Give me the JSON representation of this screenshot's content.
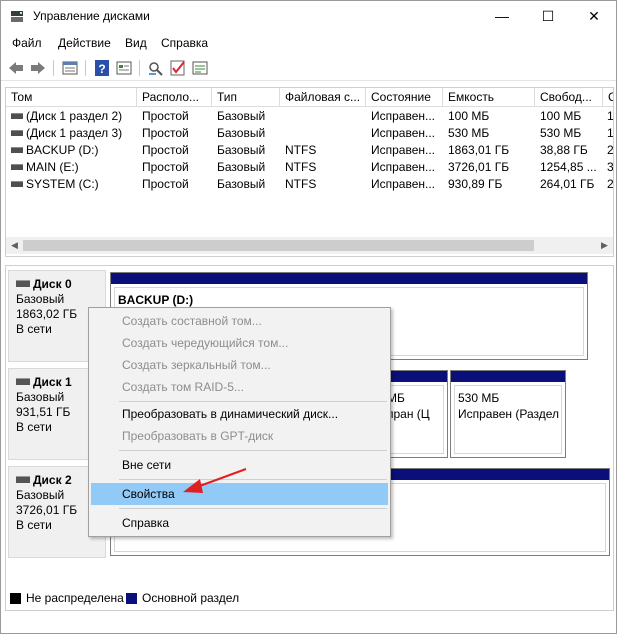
{
  "window": {
    "title": "Управление дисками",
    "controls": {
      "minimize": "—",
      "maximize": "☐",
      "close": "✕"
    }
  },
  "menu": [
    "Файл",
    "Действие",
    "Вид",
    "Справка"
  ],
  "toolbar_icons": [
    "back-arrow-icon",
    "forward-arrow-icon",
    "list-view-icon",
    "help-icon",
    "properties-icon",
    "connect-icon",
    "check-icon",
    "rescan-icon"
  ],
  "volumes": {
    "columns": [
      "Том",
      "Располо...",
      "Тип",
      "Файловая с...",
      "Состояние",
      "Емкость",
      "Свобод...",
      "С"
    ],
    "rows": [
      {
        "name": "(Диск 1 раздел 2)",
        "layout": "Простой",
        "type": "Базовый",
        "fs": "",
        "status": "Исправен...",
        "capacity": "100 МБ",
        "free": "100 МБ",
        "pct": "1"
      },
      {
        "name": "(Диск 1 раздел 3)",
        "layout": "Простой",
        "type": "Базовый",
        "fs": "",
        "status": "Исправен...",
        "capacity": "530 МБ",
        "free": "530 МБ",
        "pct": "1"
      },
      {
        "name": "BACKUP (D:)",
        "layout": "Простой",
        "type": "Базовый",
        "fs": "NTFS",
        "status": "Исправен...",
        "capacity": "1863,01 ГБ",
        "free": "38,88 ГБ",
        "pct": "2"
      },
      {
        "name": "MAIN (E:)",
        "layout": "Простой",
        "type": "Базовый",
        "fs": "NTFS",
        "status": "Исправен...",
        "capacity": "3726,01 ГБ",
        "free": "1254,85 ...",
        "pct": "3"
      },
      {
        "name": "SYSTEM (C:)",
        "layout": "Простой",
        "type": "Базовый",
        "fs": "NTFS",
        "status": "Исправен...",
        "capacity": "930,89 ГБ",
        "free": "264,01 ГБ",
        "pct": "2"
      }
    ]
  },
  "disks": [
    {
      "name": "Диск 0",
      "type": "Базовый",
      "size": "1863,02 ГБ",
      "state": "В сети"
    },
    {
      "name": "Диск 1",
      "type": "Базовый",
      "size": "931,51 ГБ",
      "state": "В сети"
    },
    {
      "name": "Диск 2",
      "type": "Базовый",
      "size": "3726,01 ГБ",
      "state": "В сети"
    }
  ],
  "partitions": {
    "backup_label": "BACKUP  (D:)",
    "disk1_p2_size": "МБ",
    "disk1_p2_status": "пран (Ц",
    "disk1_p3_size": "530 МБ",
    "disk1_p3_status": "Исправен (Раздел"
  },
  "context_menu": {
    "items": [
      {
        "label": "Создать составной том...",
        "enabled": false
      },
      {
        "label": "Создать чередующийся том...",
        "enabled": false
      },
      {
        "label": "Создать зеркальный том...",
        "enabled": false
      },
      {
        "label": "Создать том RAID-5...",
        "enabled": false
      },
      {
        "label": "Преобразовать в динамический диск...",
        "enabled": true
      },
      {
        "label": "Преобразовать в GPT-диск",
        "enabled": false
      },
      {
        "label": "Вне сети",
        "enabled": true
      },
      {
        "label": "Свойства",
        "enabled": true,
        "selected": true
      },
      {
        "label": "Справка",
        "enabled": true
      }
    ]
  },
  "legend": [
    {
      "label": "Не распределена",
      "color": "#000000"
    },
    {
      "label": "Основной раздел",
      "color": "#0a0f7a"
    }
  ],
  "colors": {
    "partition_bar": "#0a0f7a",
    "selection": "#91c9f7",
    "annotation_arrow": "#e02020"
  }
}
